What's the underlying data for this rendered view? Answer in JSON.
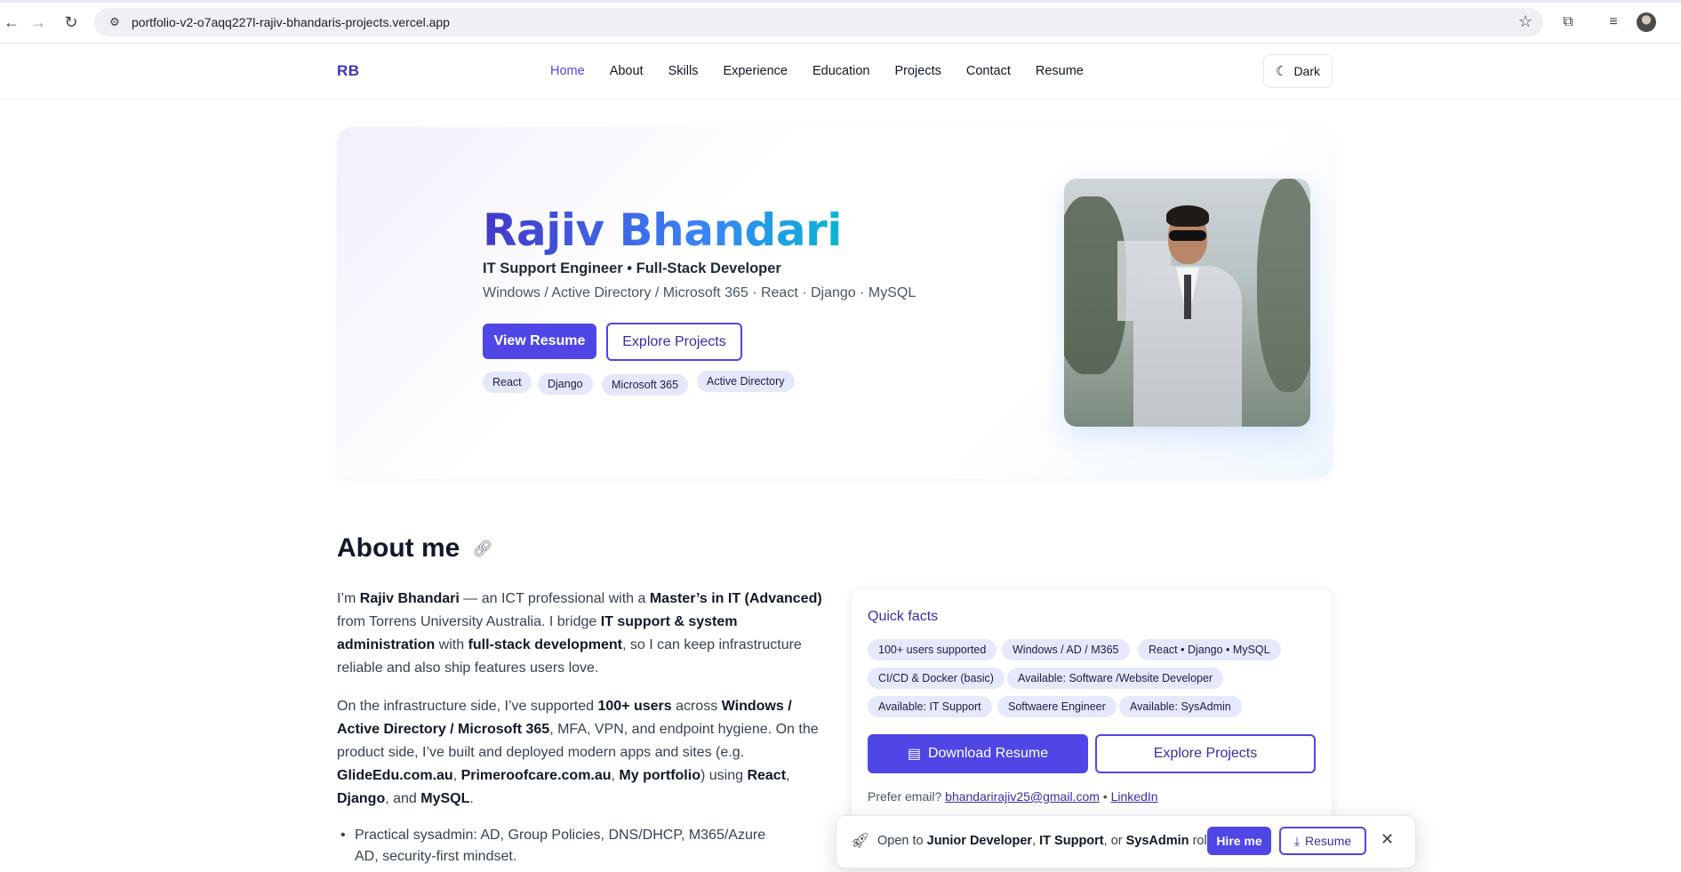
{
  "browser": {
    "url": "portfolio-v2-o7aqq227l-rajiv-bhandaris-projects.vercel.app"
  },
  "header": {
    "logo": "RB",
    "nav": [
      "Home",
      "About",
      "Skills",
      "Experience",
      "Education",
      "Projects",
      "Contact",
      "Resume"
    ],
    "active_nav": "Home",
    "theme_toggle": "Dark"
  },
  "hero": {
    "name": "Rajiv Bhandari",
    "role": "IT Support Engineer • Full-Stack Developer",
    "stack": "Windows / Active Directory / Microsoft 365 · React · Django · MySQL",
    "primary_button": "View Resume",
    "secondary_button": "Explore Projects",
    "chips": [
      "React",
      "Django",
      "Microsoft 365",
      "Active Directory"
    ]
  },
  "about": {
    "title": "About me",
    "p1_parts": [
      "I’m ",
      "Rajiv Bhandari",
      " — an ICT professional with a ",
      "Master’s in IT (Advanced)",
      " from Torrens University Australia. I bridge ",
      "IT support & system administration",
      " with ",
      "full-stack development",
      ", so I can keep infrastructure reliable and also ship features users love."
    ],
    "p2_parts": [
      "On the infrastructure side, I’ve supported ",
      "100+ users",
      " across ",
      "Windows / Active Directory / Microsoft 365",
      ", MFA, VPN, and endpoint hygiene. On the product side, I’ve built and deployed modern apps and sites (e.g. ",
      "GlideEdu.com.au",
      ", ",
      "Primeroofcare.com.au",
      ", ",
      "My portfolio",
      ") using ",
      "React",
      ", ",
      "Django",
      ", and ",
      "MySQL",
      "."
    ],
    "bullet": "Practical sysadmin: AD, Group Policies, DNS/DHCP, M365/Azure AD, security-first mindset."
  },
  "quick_facts": {
    "title": "Quick facts",
    "chips": [
      "100+ users supported",
      "Windows / AD / M365",
      "React • Django • MySQL",
      "CI/CD & Docker (basic)",
      "Available: Software /Website Developer",
      "Available: IT Support",
      "Softwaere Engineer",
      "Available: SysAdmin"
    ],
    "download_button": "Download Resume",
    "explore_button": "Explore Projects",
    "email_prefix": "Prefer email?",
    "email": "bhandarirajiv25@gmail.com",
    "separator": "•",
    "linkedin": "LinkedIn"
  },
  "toast": {
    "msg_parts": [
      "Open to ",
      "Junior Developer",
      ", ",
      "IT Support",
      ", or ",
      "SysAdmin",
      " roles."
    ],
    "hire_button": "Hire me",
    "resume_button": "Resume"
  },
  "colors": {
    "accent": "#4f46e5",
    "chip_bg": "#e5e7fb",
    "name_gradient_start": "#4338ca",
    "name_gradient_end": "#06b6d4"
  }
}
